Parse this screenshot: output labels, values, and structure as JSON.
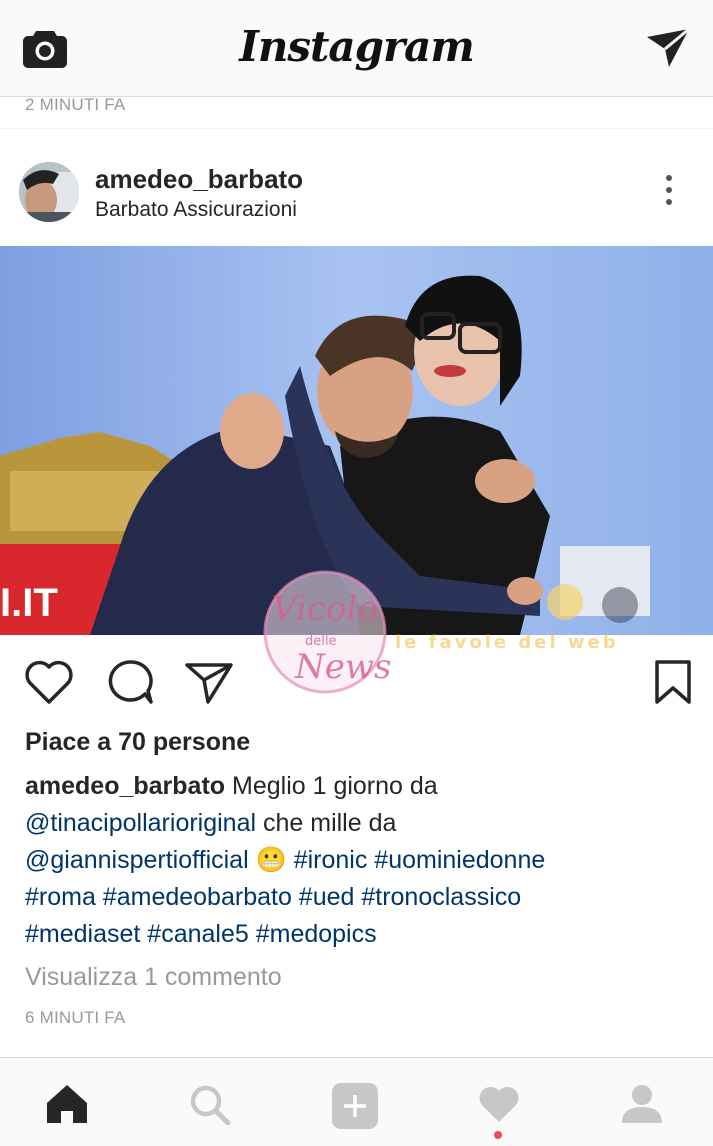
{
  "header": {
    "title": "Instagram",
    "camera_icon": "camera-icon",
    "direct_icon": "paper-plane-icon"
  },
  "previous_post": {
    "time_ago": "2 MINUTI FA"
  },
  "post": {
    "username": "amedeo_barbato",
    "location": "Barbato Assicurazioni",
    "photo": {
      "overlay_text": "I.IT"
    },
    "watermark": {
      "line1": "Vicolo",
      "line2": "delle",
      "line3": "News",
      "tagline": "le favole del web"
    },
    "likes": "Piace a 70 persone",
    "caption": {
      "username": "amedeo_barbato",
      "text1": " Meglio 1 giorno da",
      "mention1": "@tinacipollarioriginal",
      "text2": " che mille da",
      "mention2": "@giannispertiofficial",
      "emoji": "😬",
      "hashtags_line1": "#ironic #uominiedonne",
      "hashtags_line2": "#roma #amedeobarbato #ued #tronoclassico",
      "hashtags_line3": "#mediaset #canale5 #medopics"
    },
    "view_comments": "Visualizza 1 commento",
    "time_ago": "6 MINUTI FA"
  },
  "bottom_nav": {
    "items": [
      "home-icon",
      "search-icon",
      "add-icon",
      "heart-icon",
      "profile-icon"
    ],
    "activity_dot_color": "#ed4956"
  }
}
